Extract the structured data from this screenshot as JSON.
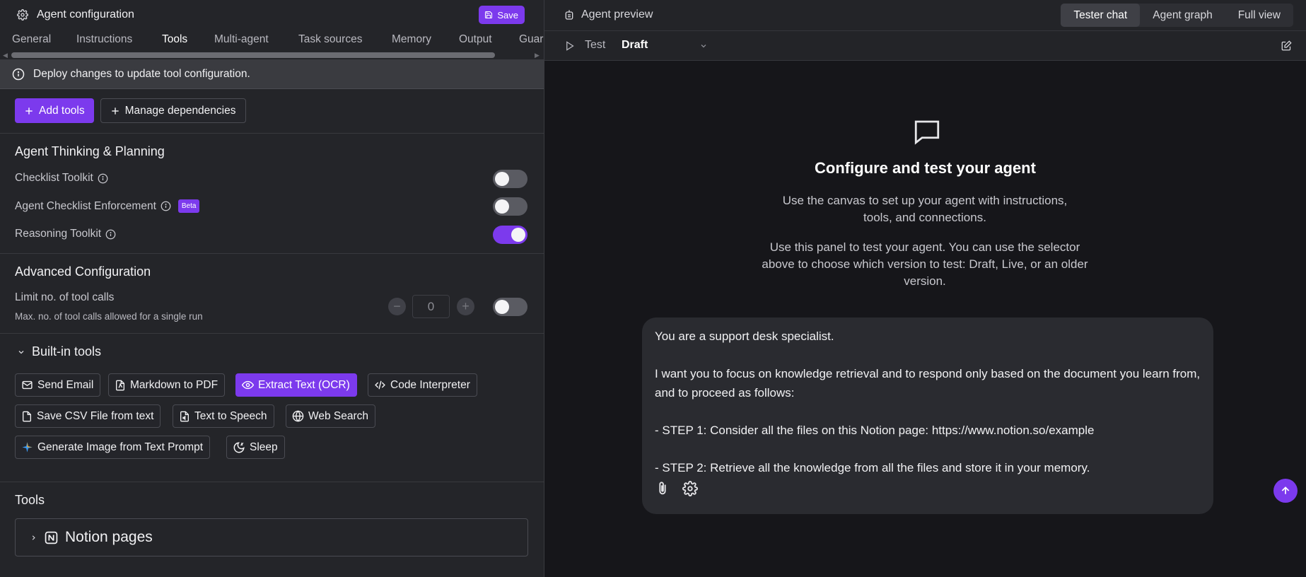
{
  "left_panel": {
    "title": "Agent configuration",
    "save_label": "Save",
    "tabs": [
      "General",
      "Instructions",
      "Tools",
      "Multi-agent",
      "Task sources",
      "Memory",
      "Output",
      "Guar"
    ],
    "active_tab": "Tools",
    "banner": "Deploy changes to update tool configuration.",
    "add_tools_label": "Add tools",
    "manage_deps_label": "Manage dependencies",
    "thinking": {
      "title": "Agent Thinking & Planning",
      "rows": [
        {
          "label": "Checklist Toolkit",
          "enabled": false
        },
        {
          "label": "Agent Checklist Enforcement",
          "badge": "Beta",
          "enabled": false
        },
        {
          "label": "Reasoning Toolkit",
          "enabled": true
        }
      ]
    },
    "advanced": {
      "title": "Advanced Configuration",
      "limit_label": "Limit no. of tool calls",
      "limit_sub": "Max. no. of tool calls allowed for a single run",
      "limit_value": "0",
      "limit_enabled": false
    },
    "builtin": {
      "title": "Built-in tools",
      "chips": [
        "Send Email",
        "Markdown to PDF",
        "Extract Text (OCR)",
        "Code Interpreter",
        "Save CSV File from text",
        "Text to Speech",
        "Web Search",
        "Generate Image from Text Prompt",
        "Sleep"
      ],
      "active_chip": "Extract Text (OCR)"
    },
    "tools": {
      "title": "Tools",
      "items": [
        "Notion pages"
      ]
    }
  },
  "right_panel": {
    "title": "Agent preview",
    "view_tabs": [
      "Tester chat",
      "Agent graph",
      "Full view"
    ],
    "active_view": "Tester chat",
    "test_label": "Test",
    "version": "Draft",
    "empty_title": "Configure and test your agent",
    "empty_p1": "Use the canvas to set up your agent with instructions, tools, and connections.",
    "empty_p2": "Use this panel to test your agent. You can use the selector above to choose which version to test: Draft, Live, or an older version.",
    "composer_lines": [
      "You are a support desk specialist.",
      "",
      "I want you to focus on knowledge retrieval and to respond only based on the document you learn from, and to proceed as follows:",
      "",
      "- STEP 1: Consider all the files on this Notion page: https://www.notion.so/example",
      "",
      "- STEP 2: Retrieve all the knowledge from all the files and store it in your memory."
    ]
  },
  "colors": {
    "accent": "#7c3aed",
    "panel_bg": "#242529",
    "preview_bg": "#16161a"
  }
}
